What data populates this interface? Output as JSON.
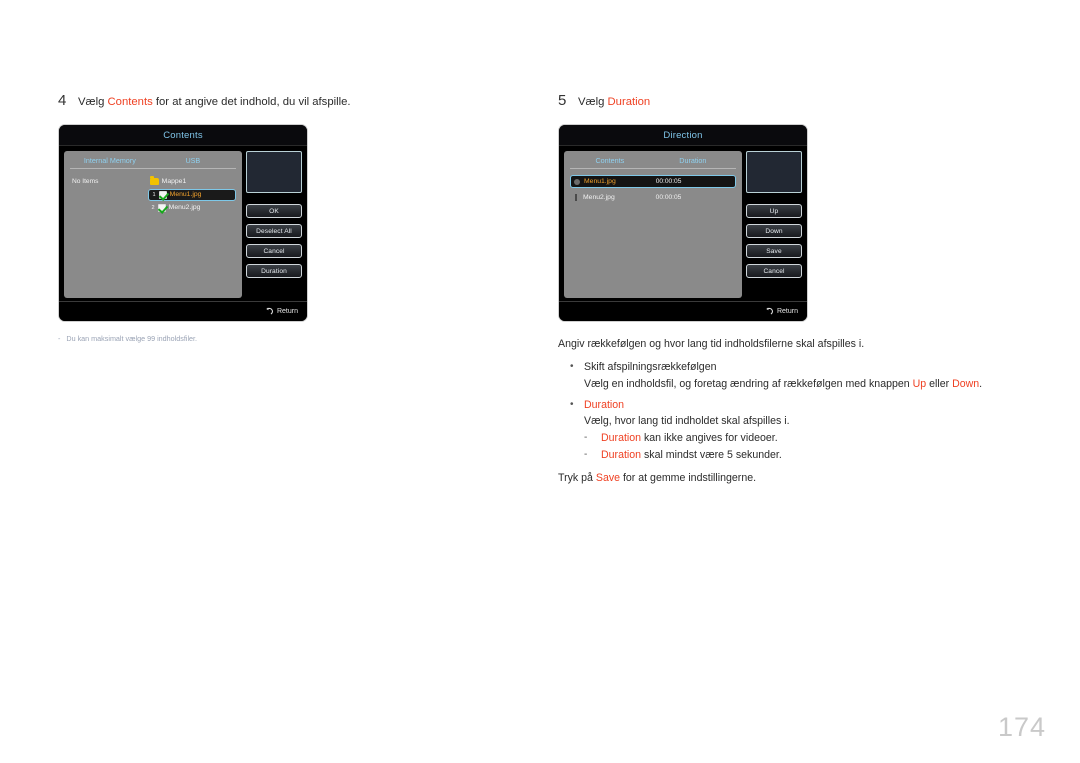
{
  "page": {
    "number": "174"
  },
  "steps": [
    {
      "number": "4",
      "text_before": "Vælg ",
      "highlight": "Contents",
      "text_after": " for at angive det indhold, du vil afspille."
    },
    {
      "number": "5",
      "text_before": "Vælg ",
      "highlight": "Duration",
      "text_after": ""
    }
  ],
  "contents_dialog": {
    "title": "Contents",
    "columns": {
      "internal_memory": "Internal Memory",
      "usb": "USB"
    },
    "internal_memory_empty": "No Items",
    "usb_items": [
      {
        "index": "",
        "label": "Mappe1",
        "type": "folder",
        "selected": false,
        "checked": false
      },
      {
        "index": "1",
        "label": "Menu1.jpg",
        "type": "file",
        "selected": true,
        "checked": true
      },
      {
        "index": "2",
        "label": "Menu2.jpg",
        "type": "file",
        "selected": false,
        "checked": true
      }
    ],
    "buttons": [
      "OK",
      "Deselect All",
      "Cancel",
      "Duration"
    ],
    "footer": "Return"
  },
  "direction_dialog": {
    "title": "Direction",
    "columns": {
      "contents": "Contents",
      "duration": "Duration"
    },
    "items": [
      {
        "label": "Menu1.jpg",
        "duration": "00:00:05",
        "handle": "dot",
        "selected": true
      },
      {
        "label": "Menu2.jpg",
        "duration": "00:00:05",
        "handle": "bar",
        "selected": false
      }
    ],
    "buttons": [
      "Up",
      "Down",
      "Save",
      "Cancel"
    ],
    "footer": "Return"
  },
  "left_note": {
    "dash": "-",
    "text": "Du kan maksimalt vælge 99 indholdsfiler."
  },
  "right_notes": {
    "lead": "Angiv rækkefølgen og hvor lang tid indholdsfilerne skal afspilles i.",
    "bullet1": {
      "marker": "•",
      "head": "Skift afspilningsrækkefølgen",
      "body_1": "Vælg en indholdsfil, og foretag ændring af rækkefølgen med knappen ",
      "hl_1": "Up",
      "body_2": " eller ",
      "hl_2": "Down",
      "body_3": "."
    },
    "bullet2": {
      "marker": "•",
      "head": "Duration",
      "body": "Vælg, hvor lang tid indholdet skal afspilles i.",
      "dashes": [
        {
          "mark": "-",
          "hl": "Duration",
          "text": " kan ikke angives for videoer."
        },
        {
          "mark": "-",
          "hl": "Duration",
          "text": " skal mindst være 5 sekunder."
        }
      ]
    },
    "closing": {
      "before": "Tryk på ",
      "hl": "Save",
      "after": " for at gemme indstillingerne."
    }
  },
  "colors": {
    "accent": "#ef4123",
    "dialog_title": "#7fc4e8",
    "selection_border": "#7ec8e8",
    "selected_text": "#f2a22c",
    "checkbox_check": "#18a81c",
    "folder": "#f2c200",
    "note_gray": "#9aa3b5",
    "page_number": "#c9c9c9"
  }
}
